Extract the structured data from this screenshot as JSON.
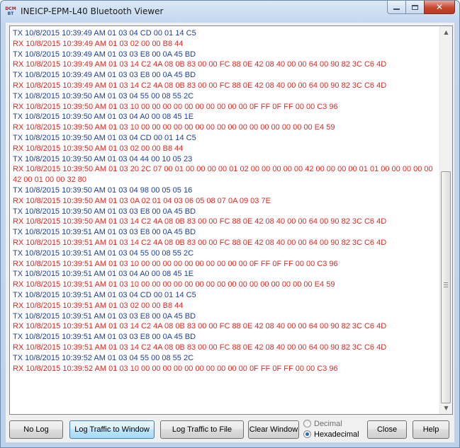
{
  "window": {
    "title": "INEICP-EPM-L40 Bluetooth Viewer",
    "icon_name": "app-icon",
    "icon_text_top": "DCM",
    "icon_text_bottom": "BT"
  },
  "colors": {
    "tx": "#1f3f9e",
    "rx": "#e8261f",
    "accent_button": "#a7d9f5"
  },
  "log": [
    {
      "dir": "tx",
      "text": "TX 10/8/2015 10:39:49 AM 01 03 04 CD 00 01 14 C5"
    },
    {
      "dir": "rx",
      "text": "RX 10/8/2015 10:39:49 AM 01 03 02 00 00 B8 44"
    },
    {
      "dir": "tx",
      "text": "TX 10/8/2015 10:39:49 AM 01 03 03 E8 00 0A 45 BD"
    },
    {
      "dir": "rx",
      "text": "RX 10/8/2015 10:39:49 AM 01 03 14 C2 4A 08 0B 83 00 00 FC 88 0E 42 08 40 00 00 64 00 90 82 3C C6 4D"
    },
    {
      "dir": "tx",
      "text": "TX 10/8/2015 10:39:49 AM 01 03 03 E8 00 0A 45 BD"
    },
    {
      "dir": "rx",
      "text": "RX 10/8/2015 10:39:49 AM 01 03 14 C2 4A 08 0B 83 00 00 FC 88 0E 42 08 40 00 00 64 00 90 82 3C C6 4D"
    },
    {
      "dir": "tx",
      "text": "TX 10/8/2015 10:39:50 AM 01 03 04 55 00 08 55 2C"
    },
    {
      "dir": "rx",
      "text": "RX 10/8/2015 10:39:50 AM 01 03 10 00 00 00 00 00 00 00 00 00 00 0F FF 0F FF 00 00 C3 96"
    },
    {
      "dir": "tx",
      "text": "TX 10/8/2015 10:39:50 AM 01 03 04 A0 00 08 45 1E"
    },
    {
      "dir": "rx",
      "text": "RX 10/8/2015 10:39:50 AM 01 03 10 00 00 00 00 00 00 00 00 00 00 00 00 00 00 00 00 E4 59"
    },
    {
      "dir": "tx",
      "text": "TX 10/8/2015 10:39:50 AM 01 03 04 CD 00 01 14 C5"
    },
    {
      "dir": "rx",
      "text": "RX 10/8/2015 10:39:50 AM 01 03 02 00 00 B8 44"
    },
    {
      "dir": "tx",
      "text": "TX 10/8/2015 10:39:50 AM 01 03 04 44 00 10 05 23"
    },
    {
      "dir": "rx",
      "text": "RX 10/8/2015 10:39:50 AM 01 03 20 2C 07 00 01 00 00 00 00 01 02 00 00 00 00 00 42 00 00 00 00 01 01 00 00 00 00 00 42 00 01 00 00 32 80"
    },
    {
      "dir": "tx",
      "text": "TX 10/8/2015 10:39:50 AM 01 03 04 98 00 05 05 16"
    },
    {
      "dir": "rx",
      "text": "RX 10/8/2015 10:39:50 AM 01 03 0A 02 01 04 03 06 05 08 07 0A 09 03 7E"
    },
    {
      "dir": "tx",
      "text": "TX 10/8/2015 10:39:50 AM 01 03 03 E8 00 0A 45 BD"
    },
    {
      "dir": "rx",
      "text": "RX 10/8/2015 10:39:50 AM 01 03 14 C2 4A 08 0B 83 00 00 FC 88 0E 42 08 40 00 00 64 00 90 82 3C C6 4D"
    },
    {
      "dir": "tx",
      "text": "TX 10/8/2015 10:39:51 AM 01 03 03 E8 00 0A 45 BD"
    },
    {
      "dir": "rx",
      "text": "RX 10/8/2015 10:39:51 AM 01 03 14 C2 4A 08 0B 83 00 00 FC 88 0E 42 08 40 00 00 64 00 90 82 3C C6 4D"
    },
    {
      "dir": "tx",
      "text": "TX 10/8/2015 10:39:51 AM 01 03 04 55 00 08 55 2C"
    },
    {
      "dir": "rx",
      "text": "RX 10/8/2015 10:39:51 AM 01 03 10 00 00 00 00 00 00 00 00 00 00 0F FF 0F FF 00 00 C3 96"
    },
    {
      "dir": "tx",
      "text": "TX 10/8/2015 10:39:51 AM 01 03 04 A0 00 08 45 1E"
    },
    {
      "dir": "rx",
      "text": "RX 10/8/2015 10:39:51 AM 01 03 10 00 00 00 00 00 00 00 00 00 00 00 00 00 00 00 00 E4 59"
    },
    {
      "dir": "tx",
      "text": "TX 10/8/2015 10:39:51 AM 01 03 04 CD 00 01 14 C5"
    },
    {
      "dir": "rx",
      "text": "RX 10/8/2015 10:39:51 AM 01 03 02 00 00 B8 44"
    },
    {
      "dir": "tx",
      "text": "TX 10/8/2015 10:39:51 AM 01 03 03 E8 00 0A 45 BD"
    },
    {
      "dir": "rx",
      "text": "RX 10/8/2015 10:39:51 AM 01 03 14 C2 4A 08 0B 83 00 00 FC 88 0E 42 08 40 00 00 64 00 90 82 3C C6 4D"
    },
    {
      "dir": "tx",
      "text": "TX 10/8/2015 10:39:51 AM 01 03 03 E8 00 0A 45 BD"
    },
    {
      "dir": "rx",
      "text": "RX 10/8/2015 10:39:51 AM 01 03 14 C2 4A 08 0B 83 00 00 FC 88 0E 42 08 40 00 00 64 00 90 82 3C C6 4D"
    },
    {
      "dir": "tx",
      "text": "TX 10/8/2015 10:39:52 AM 01 03 04 55 00 08 55 2C"
    },
    {
      "dir": "rx",
      "text": "RX 10/8/2015 10:39:52 AM 01 03 10 00 00 00 00 00 00 00 00 00 00 0F FF 0F FF 00 00 C3 96"
    }
  ],
  "scrollbar": {
    "up_icon": "chevron-up-icon",
    "down_icon": "chevron-down-icon"
  },
  "buttons": {
    "no_log": "No Log",
    "log_window": "Log Traffic to Window",
    "log_file": "Log Traffic to File",
    "clear_window": "Clear Window",
    "close": "Close",
    "help": "Help"
  },
  "format": {
    "options": [
      {
        "label": "Decimal",
        "selected": false
      },
      {
        "label": "Hexadecimal",
        "selected": true
      }
    ]
  }
}
